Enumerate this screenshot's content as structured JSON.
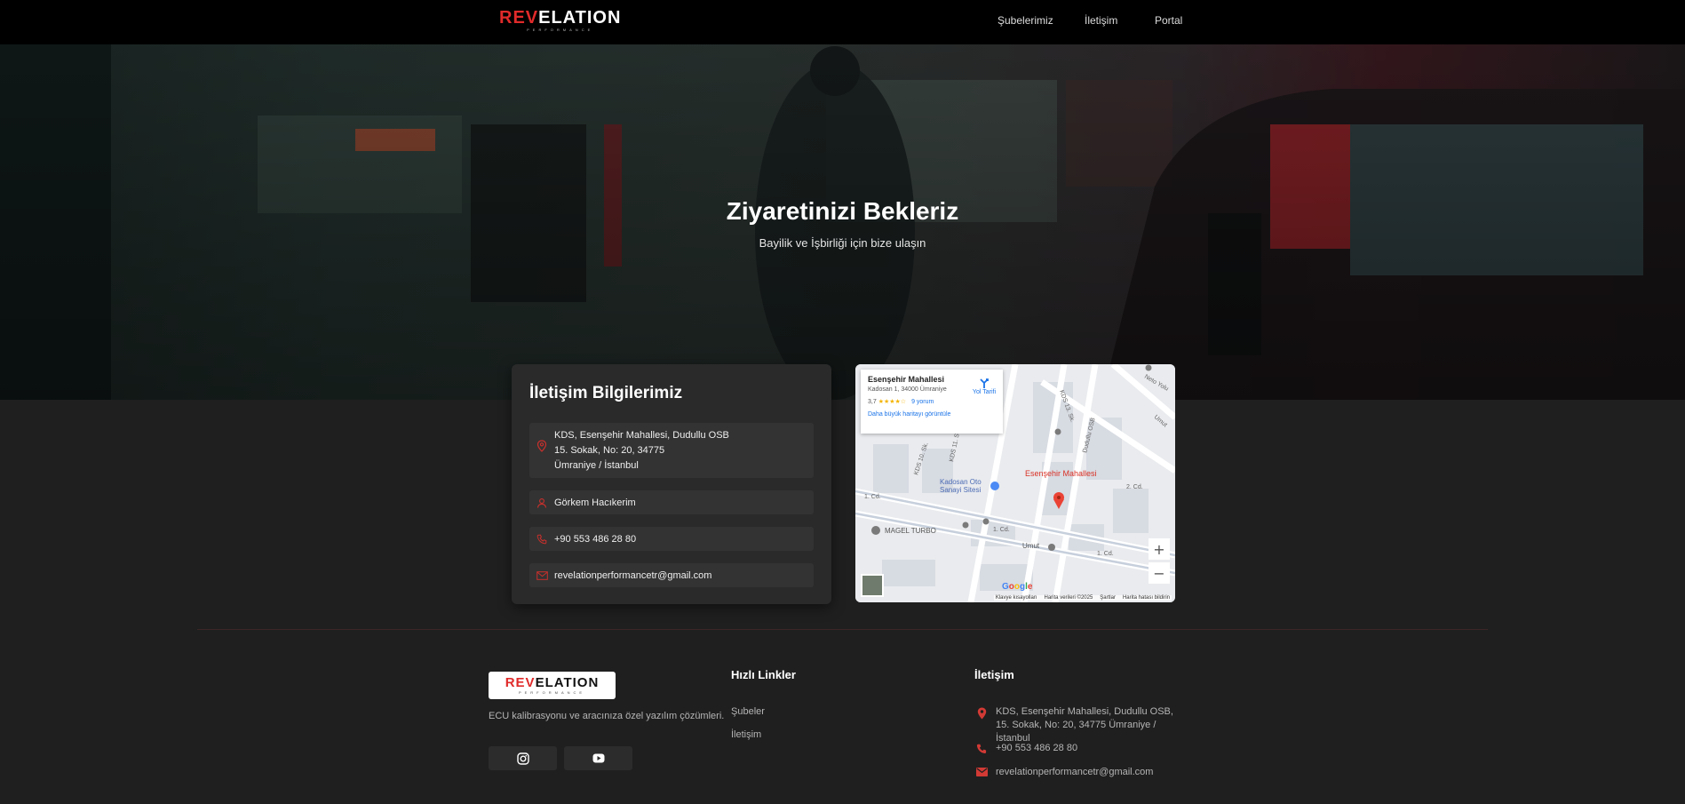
{
  "brand": {
    "logo_red": "REV",
    "logo_white": "ELATION",
    "logo_sub": "PERFORMANCE",
    "accent": "#e02a2a"
  },
  "nav": {
    "links": [
      "Şubelerimiz",
      "İletişim",
      "Portal"
    ]
  },
  "hero": {
    "title": "Ziyaretinizi Bekleriz",
    "subtitle": "Bayilik ve İşbirliği için bize ulaşın"
  },
  "contact": {
    "title": "İletişim Bilgilerimiz",
    "address_lines": [
      "KDS, Esenşehir Mahallesi, Dudullu OSB",
      "15. Sokak, No: 20, 34775",
      "Ümraniye / İstanbul"
    ],
    "person": "Görkem Hacıkerim",
    "phone": "+90 553 486 28 80",
    "email": "revelationperformancetr@gmail.com"
  },
  "map": {
    "place": "Esenşehir Mahallesi",
    "address": "Kadosan 1, 34000 Ümraniye",
    "rating": "3,7",
    "stars": "★★★★☆",
    "reviews": "9 yorum",
    "larger_map": "Daha büyük haritayı görüntüle",
    "directions": "Yol Tarifi",
    "pin_label": "Esenşehir Mahallesi",
    "poi_1": "Kadosan Oto Sanayi Sitesi",
    "poi_2": "MAGEL TURBO",
    "poi_3": "Umut",
    "footer": [
      "Klavye kısayolları",
      "Harita verileri ©2025",
      "Şartlar",
      "Harita hatası bildirin"
    ],
    "streets": [
      "KDS 13. Sk.",
      "KDS 11. Sk.",
      "KDS 10. Sk.",
      "Dudullu OSB",
      "1. Cd.",
      "2. Cd.",
      "Neto Yolu",
      "Umut"
    ]
  },
  "footer": {
    "description": "ECU kalibrasyonu ve aracınıza özel yazılım çözümleri.",
    "quick_title": "Hızlı Linkler",
    "quick_links": [
      "Şubeler",
      "İletişim"
    ],
    "contact_title": "İletişim",
    "address": "KDS, Esenşehir Mahallesi, Dudullu OSB, 15. Sokak, No: 20, 34775 Ümraniye / İstanbul",
    "phone": "+90 553 486 28 80",
    "email": "revelationperformancetr@gmail.com"
  }
}
